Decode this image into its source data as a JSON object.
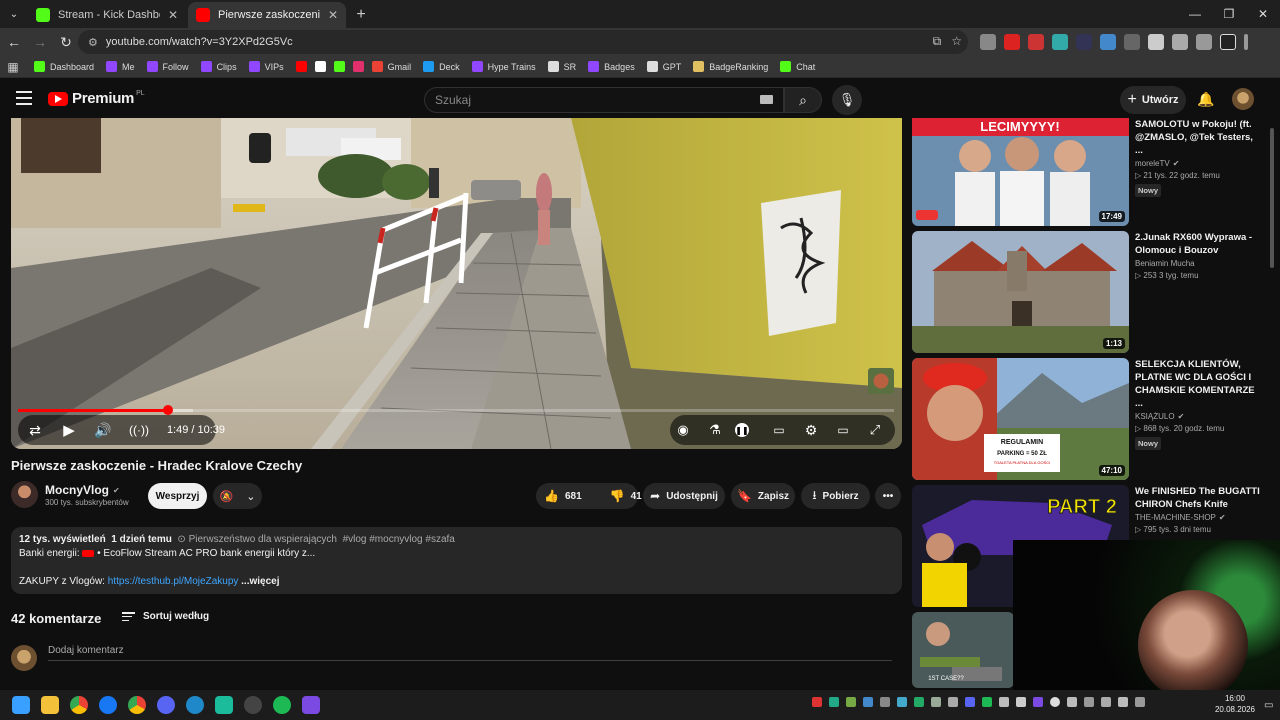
{
  "browser": {
    "tabs": [
      {
        "title": "Stream - Kick Dashboard",
        "favicon_color": "#53fc18",
        "active": false
      },
      {
        "title": "Pierwsze zaskoczenie - Hradec",
        "favicon_color": "#ff0000",
        "active": true
      }
    ],
    "url": "youtube.com/watch?v=3Y2XPd2G5Vc",
    "bookmarks": [
      {
        "label": "Dashboard",
        "icon_color": "#53fc18"
      },
      {
        "label": "Me",
        "icon_color": "#9146ff"
      },
      {
        "label": "Follow",
        "icon_color": "#9146ff"
      },
      {
        "label": "Clips",
        "icon_color": "#9146ff"
      },
      {
        "label": "VIPs",
        "icon_color": "#9146ff"
      },
      {
        "label": "",
        "icon_color": "#ff0000"
      },
      {
        "label": "",
        "icon_color": "#ffffff"
      },
      {
        "label": "",
        "icon_color": "#53fc18"
      },
      {
        "label": "",
        "icon_color": "#e1306c"
      },
      {
        "label": "Gmail",
        "icon_color": "#ea4335"
      },
      {
        "label": "Deck",
        "icon_color": "#1d9bf0"
      },
      {
        "label": "Hype Trains",
        "icon_color": "#9146ff"
      },
      {
        "label": "SR",
        "icon_color": "#dddddd"
      },
      {
        "label": "Badges",
        "icon_color": "#9146ff"
      },
      {
        "label": "GPT",
        "icon_color": "#dddddd"
      },
      {
        "label": "BadgeRanking",
        "icon_color": "#e0c060"
      },
      {
        "label": "Chat",
        "icon_color": "#53fc18"
      }
    ]
  },
  "youtube": {
    "logo_text": "Premium",
    "logo_country": "PL",
    "search_placeholder": "Szukaj",
    "create_label": "Utwórz"
  },
  "player": {
    "time": "1:49 / 10:39",
    "progress_fraction": 0.171,
    "buffered_fraction": 0.2
  },
  "video": {
    "title": "Pierwsze zaskoczenie - Hradec Kralove Czechy",
    "channel": "MocnyVlog",
    "subscribers": "300 tys. subskrybentów",
    "support_label": "Wesprzyj",
    "likes": "681",
    "dislikes": "41",
    "share_label": "Udostępnij",
    "save_label": "Zapisz",
    "download_label": "Pobierz",
    "views": "12 tys. wyświetleń",
    "age": "1 dzień temu",
    "members_first": "Pierwszeństwo dla wspierających",
    "tags": "#vlog #mocnyvlog #szafa",
    "desc_line1_prefix": "Banki energii:",
    "desc_line1_text": "• EcoFlow Stream AC PRO bank energii który z...",
    "desc_line3_prefix": "ZAKUPY z Vlogów:",
    "desc_link": "https://testhub.pl/MojeZakupy",
    "more_label": "...więcej"
  },
  "comments": {
    "count_label": "42 komentarze",
    "sort_label": "Sortuj według",
    "add_placeholder": "Dodaj komentarz"
  },
  "recommendations": [
    {
      "title": "SAMOLOTU w Pokoju! (ft. @ZMASLO, @Tek Testers, ...",
      "channel": "moreleTV",
      "verified": true,
      "meta": "21 tys.  22 godz. temu",
      "badge": "Nowy",
      "duration": "17:49"
    },
    {
      "title": "2.Junak RX600 Wyprawa - Olomouc i Bouzov",
      "channel": "Beniamin Mucha",
      "verified": false,
      "meta": "253  3 tyg. temu",
      "badge": "",
      "duration": "1:13"
    },
    {
      "title": "SELEKCJA KLIENTÓW, PLATNE WC DLA GOŚCI I CHAMSKIE KOMENTARZE ...",
      "channel": "KSIĄŻULO",
      "verified": true,
      "meta": "868 tys.  20 godz. temu",
      "badge": "Nowy",
      "duration": "47:10"
    },
    {
      "title": "We FINISHED The BUGATTI CHIRON Chefs Knife",
      "channel": "THE-MACHINE-SHOP",
      "verified": true,
      "meta": "795 tys.  3 dni temu",
      "badge": "",
      "duration": ""
    }
  ],
  "thumb_texts": {
    "rec1": "LECIMYYYY!",
    "rec3_sign_line1": "REGULAMIN",
    "rec3_sign_line2": "PARKING = 50 ZŁ",
    "rec3_sign_line3": "TOALETA PŁATNA DLA GOŚCI",
    "rec4": "PART 2",
    "rec5": "1ST CASE??"
  },
  "taskbar": {
    "time": "16:00",
    "date": "20.08.2026"
  }
}
